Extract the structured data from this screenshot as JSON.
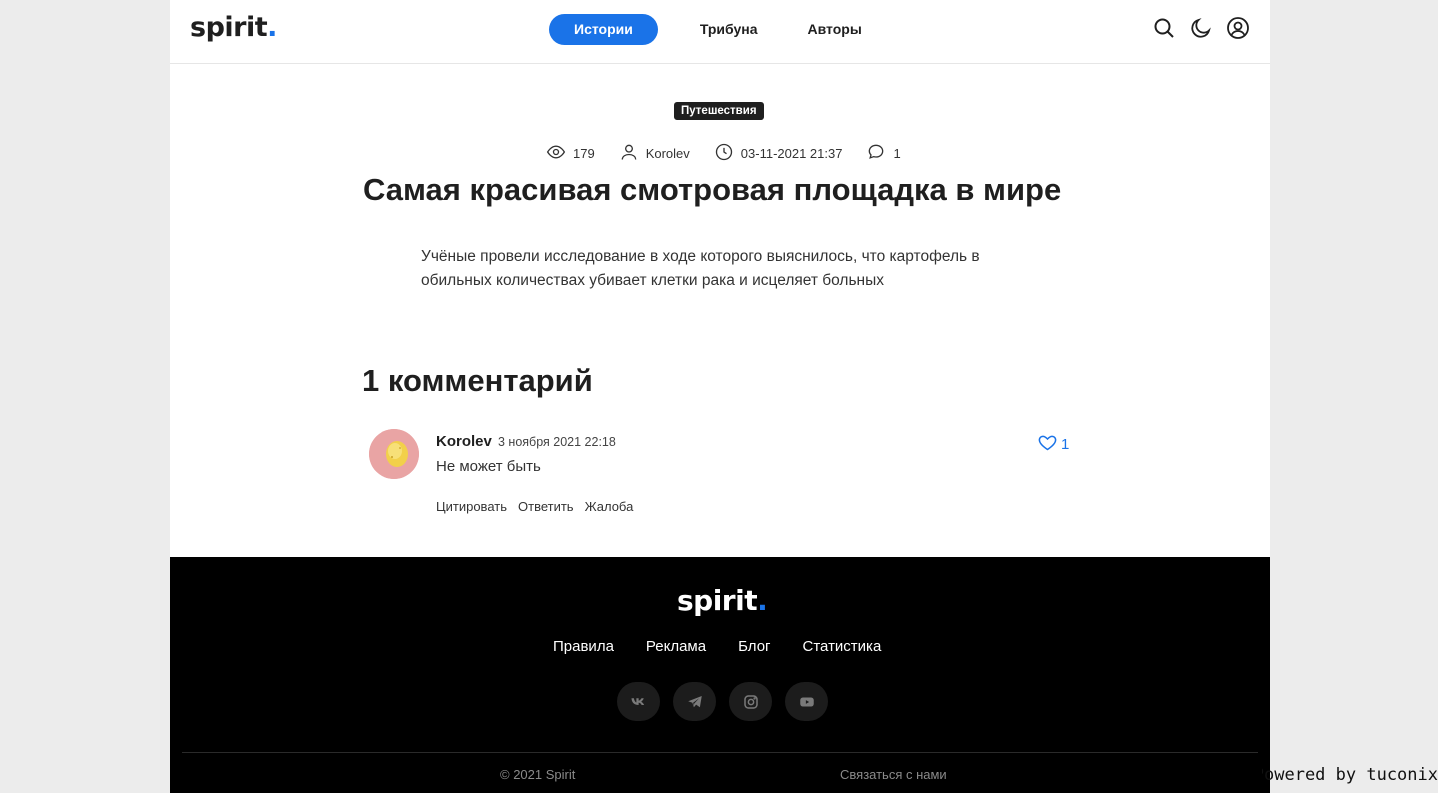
{
  "header": {
    "logo_text": "spirit",
    "logo_dot": ".",
    "nav": [
      {
        "label": "Истории",
        "active": true
      },
      {
        "label": "Трибуна",
        "active": false
      },
      {
        "label": "Авторы",
        "active": false
      }
    ],
    "icons": [
      "search-icon",
      "moon-icon",
      "user-icon"
    ]
  },
  "article": {
    "tag": "Путешествия",
    "views": "179",
    "author": "Korolev",
    "datetime": "03-11-2021 21:37",
    "comments_count": "1",
    "title": "Самая красивая смотровая площадка в мире",
    "body": "Учёные провели исследование в ходе которого выяснилось, что картофель в обильных количествах убивает клетки рака и исцеляет больных"
  },
  "comments": {
    "heading": "1 комментарий",
    "items": [
      {
        "author": "Korolev",
        "date": "3 ноября 2021 22:18",
        "text": "Не может быть",
        "likes": "1",
        "actions": {
          "quote": "Цитировать",
          "reply": "Ответить",
          "report": "Жалоба"
        }
      }
    ]
  },
  "footer": {
    "logo_text": "spirit",
    "logo_dot": ".",
    "links": [
      "Правила",
      "Реклама",
      "Блог",
      "Статистика"
    ],
    "socials": [
      "vk-icon",
      "telegram-icon",
      "instagram-icon",
      "youtube-icon"
    ],
    "copyright": "© 2021 Spirit",
    "contact": "Связаться с нами"
  },
  "powered_by": "Powered by tuconix ©",
  "colors": {
    "accent": "#1a73e8",
    "footer_bg": "#000000",
    "page_bg": "#ececec"
  }
}
